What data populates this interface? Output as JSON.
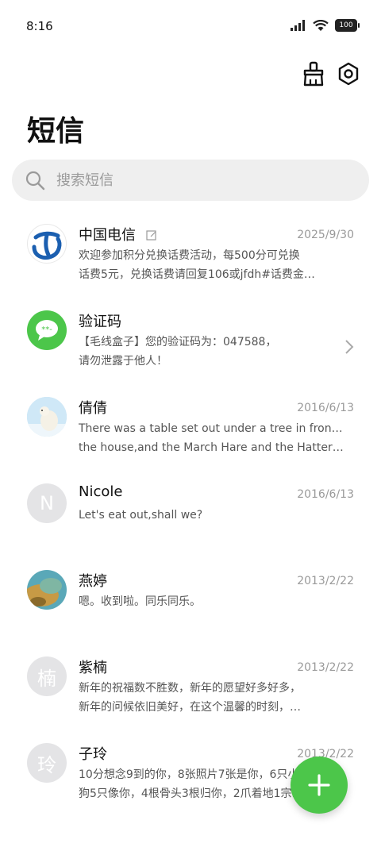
{
  "status": {
    "time": "8:16",
    "battery": "100"
  },
  "header": {
    "title": "短信"
  },
  "search": {
    "placeholder": "搜索短信"
  },
  "colors": {
    "accent": "#4cc64a",
    "avatar_gray": "#e4e4e6",
    "search_bg": "#efefef"
  },
  "conversations": [
    {
      "name": "中国电信",
      "date": "2025/9/30",
      "line1": "欢迎参加积分兑换话费活动，每500分可兑换",
      "line2": "话费5元，兑换话费请回复106或jfdh#话费金…"
    },
    {
      "name": "验证码",
      "date": "",
      "line1": "【毛线盒子】您的验证码为：047588，",
      "line2": "请勿泄露于他人！"
    },
    {
      "name": "倩倩",
      "date": "2016/6/13",
      "line1": "There was a table set out under a tree in front of",
      "line2": "the house,and the March Hare and the Hatter w…"
    },
    {
      "name": "Nicole",
      "date": "2016/6/13",
      "avatar_letter": "N",
      "line1": "Let's eat out,shall we?",
      "line2": ""
    },
    {
      "name": "燕婷",
      "date": "2013/2/22",
      "line1": "嗯。收到啦。同乐同乐。",
      "line2": ""
    },
    {
      "name": "紫楠",
      "date": "2013/2/22",
      "avatar_letter": "楠",
      "line1": "新年的祝福数不胜数，新年的愿望好多好多，",
      "line2": "新年的问候依旧美好，在这个温馨的时刻，…"
    },
    {
      "name": "子玲",
      "date": "2013/2/22",
      "avatar_letter": "玲",
      "line1": "10分想念9到的你，8张照片7张是你，6只小",
      "line2": "狗5只像你，4根骨头3根归你，2爪着地1宗…"
    }
  ]
}
